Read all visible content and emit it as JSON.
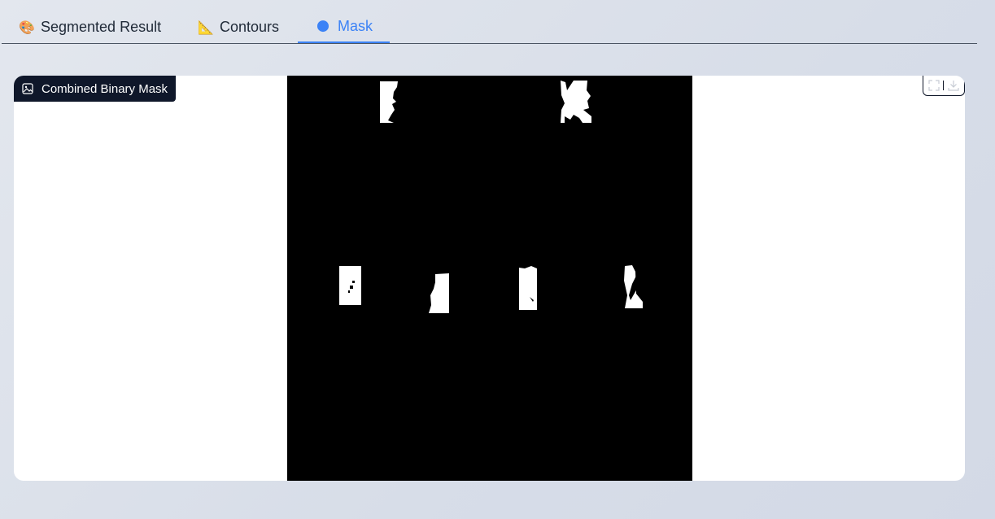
{
  "tabs": [
    {
      "label": "Segmented Result",
      "icon": "palette-icon",
      "emoji": "🎨",
      "active": false
    },
    {
      "label": "Contours",
      "icon": "triangle-ruler-icon",
      "emoji": "📐",
      "active": false
    },
    {
      "label": "Mask",
      "icon": "black-circle-icon",
      "emoji": "🌑",
      "active": true
    }
  ],
  "panel": {
    "label": "Combined Binary Mask",
    "label_icon": "image-icon",
    "toolbar": {
      "fullscreen_icon": "fullscreen-icon",
      "download_icon": "download-icon"
    }
  },
  "colors": {
    "accent": "#3b82f6",
    "chip_bg": "#0f172a",
    "mask_bg": "#000000",
    "mask_fg": "#ffffff"
  }
}
